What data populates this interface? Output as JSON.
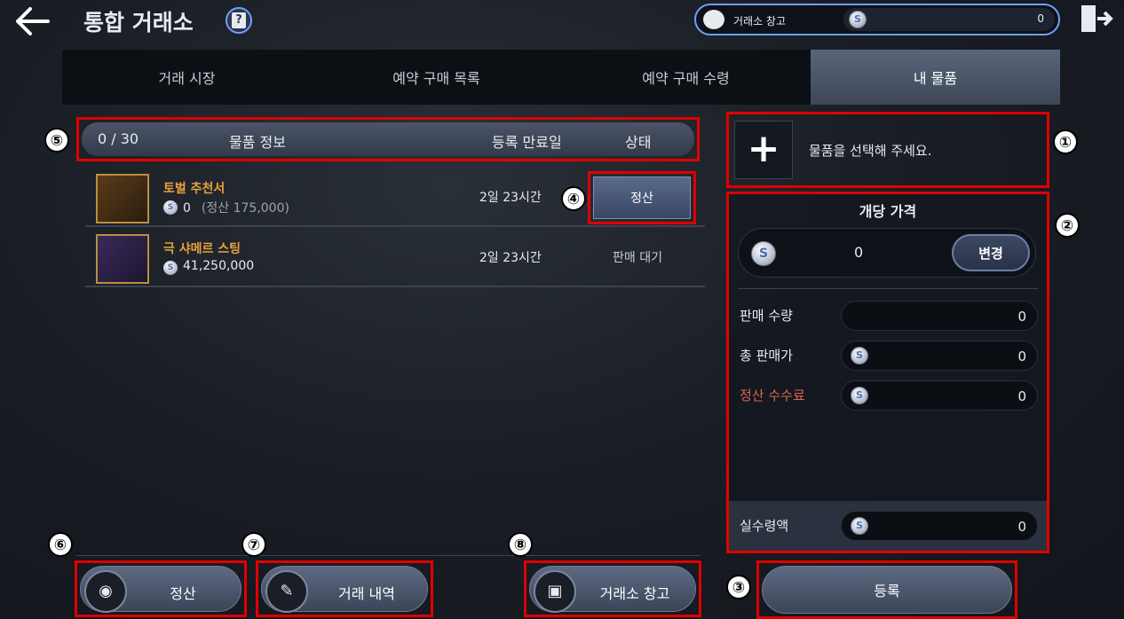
{
  "header": {
    "title": "통합 거래소",
    "warehouse_label": "거래소 창고",
    "warehouse_value": "0"
  },
  "tabs": [
    {
      "label": "거래 시장"
    },
    {
      "label": "예약 구매 목록"
    },
    {
      "label": "예약 구매 수령"
    },
    {
      "label": "내 물품"
    }
  ],
  "table": {
    "count": "0 / 30",
    "col_info": "물품 정보",
    "col_expiry": "등록 만료일",
    "col_status": "상태",
    "rows": [
      {
        "name": "토벌 추천서",
        "price": "0",
        "sub": "(정산 175,000)",
        "expiry": "2일 23시간",
        "status": "정산"
      },
      {
        "name": "극 샤메르 스팅",
        "price": "41,250,000",
        "expiry": "2일 23시간",
        "status": "판매 대기"
      }
    ]
  },
  "panel": {
    "select_text": "물품을 선택해 주세요.",
    "unit_price_title": "개당 가격",
    "unit_price": "0",
    "change_label": "변경",
    "qty_label": "판매 수량",
    "qty_value": "0",
    "total_label": "총 판매가",
    "total_value": "0",
    "fee_label": "정산 수수료",
    "fee_value": "0",
    "net_label": "실수령액",
    "net_value": "0"
  },
  "buttons": {
    "settle": "정산",
    "history": "거래 내역",
    "warehouse": "거래소 창고",
    "register": "등록"
  },
  "badges": [
    "①",
    "②",
    "③",
    "④",
    "⑤",
    "⑥",
    "⑦",
    "⑧"
  ],
  "colors": {
    "accent": "#6ea0ff",
    "highlight": "#e00000",
    "item_name": "#e8a23a",
    "fee": "#e26350"
  }
}
